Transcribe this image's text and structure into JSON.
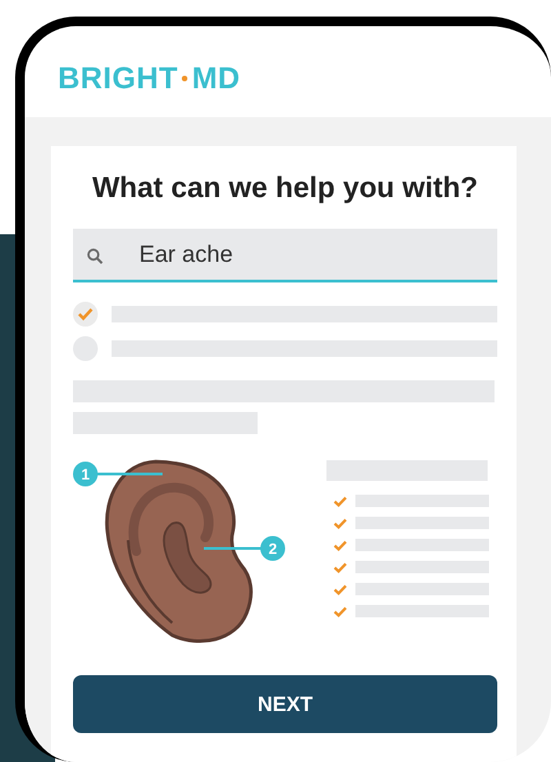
{
  "logo": {
    "left": "BRIGHT",
    "right": "MD"
  },
  "question": "What can we help you with?",
  "search": {
    "value": "Ear ache"
  },
  "options": [
    {
      "checked": true
    },
    {
      "checked": false
    }
  ],
  "callouts": [
    "1",
    "2"
  ],
  "button": "NEXT"
}
